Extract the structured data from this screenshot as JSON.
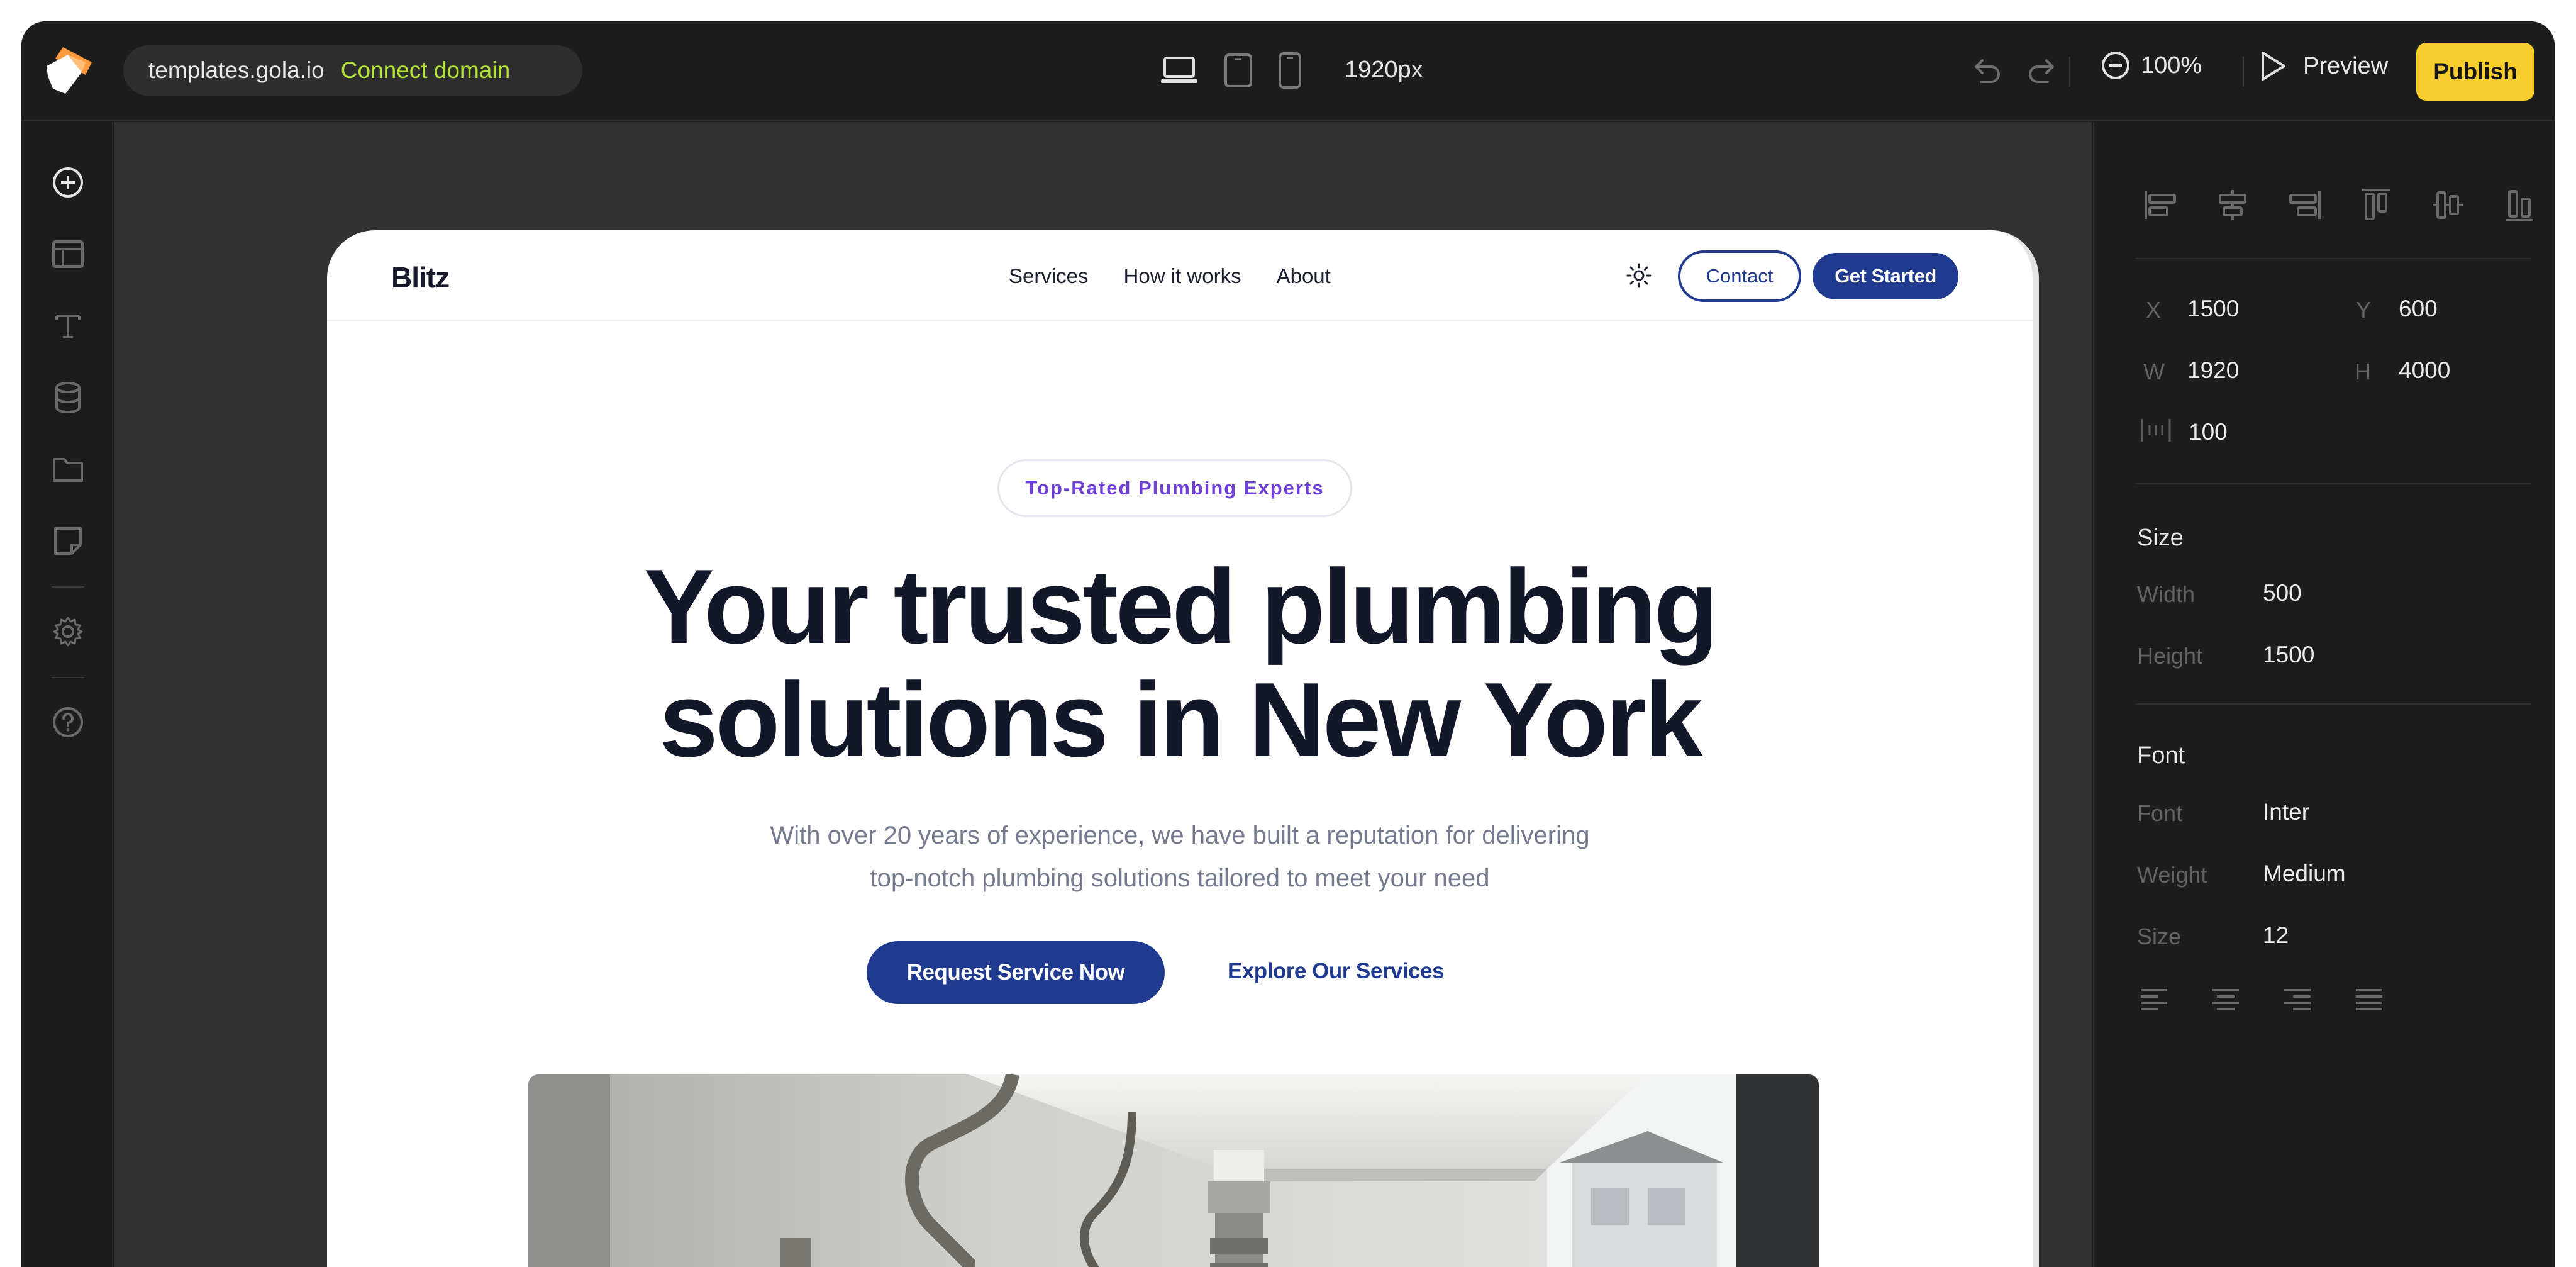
{
  "topbar": {
    "domain": "templates.gola.io",
    "connect_domain": "Connect domain",
    "width_label": "1920px",
    "zoom": "100%",
    "preview": "Preview",
    "publish": "Publish"
  },
  "site": {
    "brand": "Blitz",
    "nav": [
      "Services",
      "How it works",
      "About"
    ],
    "contact": "Contact",
    "get_started": "Get Started",
    "badge": "Top-Rated Plumbing Experts",
    "headline_line1": "Your trusted plumbing",
    "headline_line2": "solutions in New York",
    "subtext_line1": "With over 20 years of experience, we have built a reputation for delivering",
    "subtext_line2": "top-notch plumbing solutions tailored to meet your need",
    "cta_primary": "Request Service Now",
    "cta_secondary": "Explore Our Services"
  },
  "panel": {
    "x_label": "X",
    "x_value": "1500",
    "y_label": "Y",
    "y_value": "600",
    "w_label": "W",
    "w_value": "1920",
    "h_label": "H",
    "h_value": "4000",
    "spacing_value": "100",
    "size_title": "Size",
    "width_label": "Width",
    "width_value": "500",
    "height_label": "Height",
    "height_value": "1500",
    "font_title": "Font",
    "font_label": "Font",
    "font_value": "Inter",
    "weight_label": "Weight",
    "weight_value": "Medium",
    "size_label": "Size",
    "size_value": "12"
  },
  "colors": {
    "accent_publish": "#f7cd2f",
    "connect_link": "#b6e33b",
    "site_primary": "#1f3a8f",
    "badge_text": "#6d3fd6"
  },
  "icons": {
    "left_toolbar": [
      "plus-circle-icon",
      "layout-icon",
      "text-icon",
      "database-icon",
      "folder-icon",
      "note-icon",
      "gear-icon",
      "help-icon"
    ],
    "devices": [
      "laptop-icon",
      "tablet-icon",
      "phone-icon"
    ]
  }
}
